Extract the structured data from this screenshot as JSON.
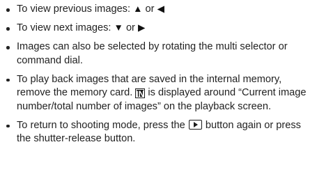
{
  "items": [
    {
      "prefix": "To view previous images: ",
      "icon_a": "▲",
      "connector": " or ",
      "icon_b": "◀",
      "icon_names": [
        "up-arrow-icon",
        "left-arrow-icon"
      ]
    },
    {
      "prefix": "To view next images: ",
      "icon_a": "▼",
      "connector": " or ",
      "icon_b": "▶",
      "icon_names": [
        "down-arrow-icon",
        "right-arrow-icon"
      ]
    },
    {
      "text": "Images can also be selected by rotating the multi selector or command dial."
    },
    {
      "before": "To play back images that are saved in the internal memory, remove the memory card. ",
      "icon": "IN",
      "icon_name": "internal-memory-icon",
      "after": " is displayed around “Current image number/total number of images” on the playback screen."
    },
    {
      "before": "To return to shooting mode, press the ",
      "icon_name": "playback-button-icon",
      "after": " button again or press the shutter-release button."
    }
  ]
}
